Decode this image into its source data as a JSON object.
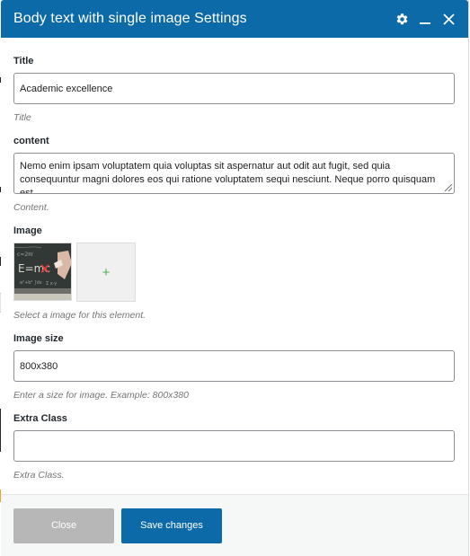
{
  "colors": {
    "header_bg": "#0d6aa8",
    "primary_button": "#0d6aa8",
    "close_button": "#b7b7b7",
    "add_icon": "#4caf50"
  },
  "header": {
    "title": "Body text with single image Settings",
    "icons": [
      "gear-icon",
      "minimize-icon",
      "close-icon"
    ]
  },
  "fields": {
    "title": {
      "label": "Title",
      "value": "Academic excellence",
      "help": "Title"
    },
    "content": {
      "label": "content",
      "value": "Nemo enim ipsam voluptatem quia voluptas sit aspernatur aut odit aut fugit, sed quia consequuntur magni dolores eos qui ratione voluptatem sequi nesciunt. Neque porro quisquam est",
      "help": "Content."
    },
    "image": {
      "label": "Image",
      "add_symbol": "+",
      "help": "Select a image for this element."
    },
    "image_size": {
      "label": "Image size",
      "value": "800x380",
      "help": "Enter a size for image. Example: 800x380"
    },
    "extra_class": {
      "label": "Extra Class",
      "value": "",
      "help": "Extra Class."
    }
  },
  "footer": {
    "close_label": "Close",
    "save_label": "Save changes"
  }
}
